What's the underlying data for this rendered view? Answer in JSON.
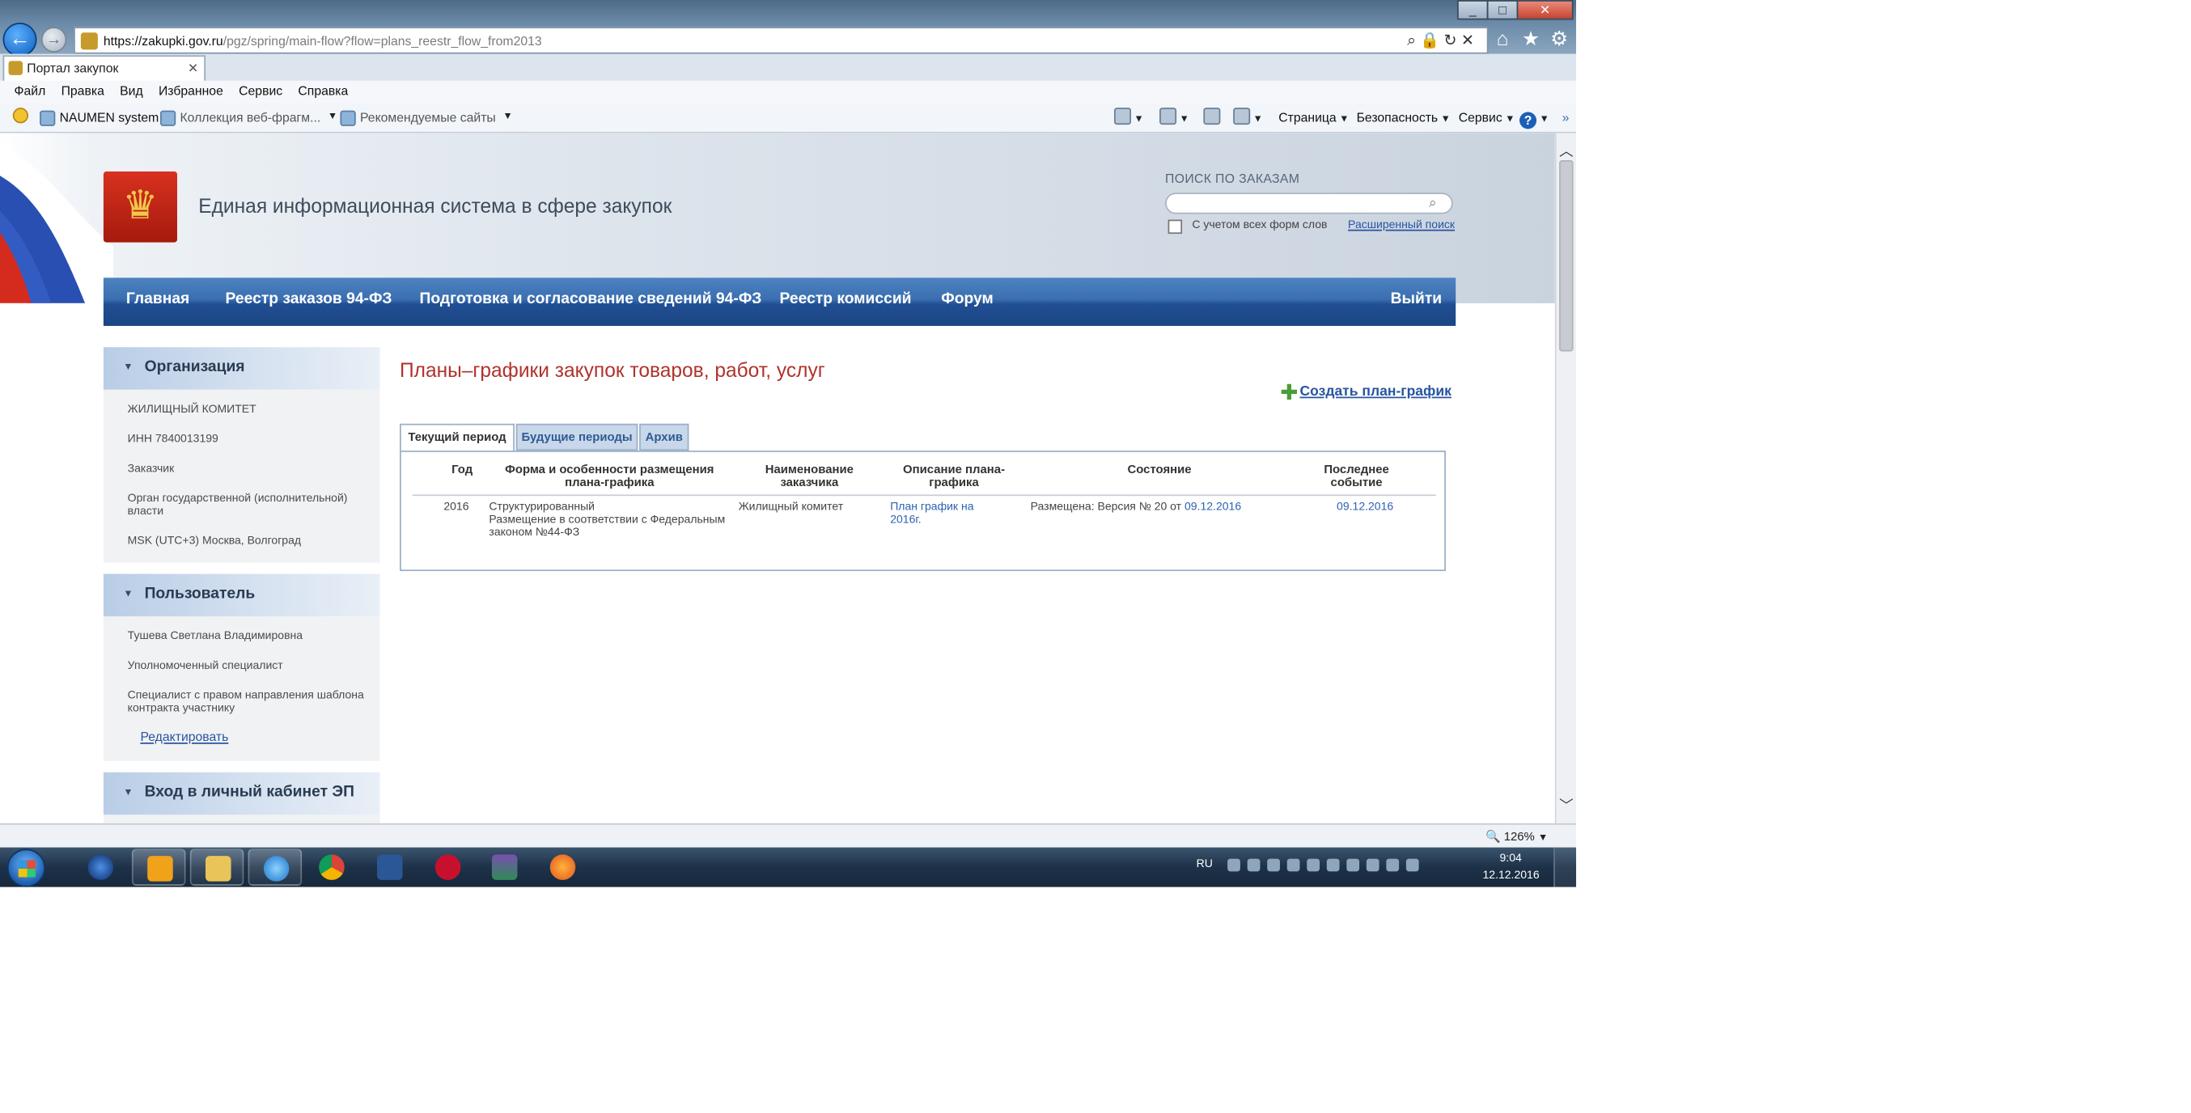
{
  "browser": {
    "url_host": "https://zakupki.gov.ru",
    "url_path": "/pgz/spring/main-flow?flow=plans_reestr_flow_from2013",
    "tab_title": "Портал закупок",
    "menu": [
      "Файл",
      "Правка",
      "Вид",
      "Избранное",
      "Сервис",
      "Справка"
    ],
    "favorites": [
      "NAUMEN system",
      "Коллекция веб-фрагм...",
      "Рекомендуемые сайты"
    ],
    "commands": {
      "page": "Страница",
      "safety": "Безопасность",
      "tools": "Сервис"
    },
    "zoom": "126%"
  },
  "site": {
    "title": "Единая информационная система в сфере закупок",
    "search_label": "ПОИСК ПО ЗАКАЗАМ",
    "search_value": "",
    "forms_checkbox_label": "С учетом всех форм слов",
    "advanced_search": "Расширенный поиск",
    "nav": {
      "home": "Главная",
      "registry94": "Реестр заказов 94-ФЗ",
      "prep94": "Подготовка и согласование сведений 94-ФЗ",
      "sep": "-",
      "commissions": "Реестр комиссий",
      "forum": "Форум",
      "logout": "Выйти"
    }
  },
  "sidebar": {
    "org": {
      "heading": "Организация",
      "name": "ЖИЛИЩНЫЙ КОМИТЕТ",
      "inn": "ИНН 7840013199",
      "role": "Заказчик",
      "type": "Орган государственной (исполнительной) власти",
      "tz": "MSK (UTC+3) Москва, Волгоград"
    },
    "user": {
      "heading": "Пользователь",
      "name": "Тушева Светлана Владимировна",
      "role1": "Уполномоченный специалист",
      "role2": "Специалист с правом направления шаблона контракта участнику",
      "edit": "Редактировать"
    },
    "cabinet": {
      "heading": "Вход в личный кабинет ЭП"
    }
  },
  "main": {
    "title": "Планы–графики закупок товаров, работ, услуг",
    "create": "Создать план-график",
    "tabs": {
      "current": "Текущий период",
      "future": "Будущие периоды",
      "archive": "Архив"
    },
    "columns": {
      "year": "Год",
      "form": "Форма и особенности размещения плана-графика",
      "customer": "Наименование заказчика",
      "desc": "Описание плана-графика",
      "state": "Состояние",
      "last": "Последнее событие"
    },
    "rows": [
      {
        "year": "2016",
        "form1": "Структурированный",
        "form2": "Размещение в соответствии с Федеральным законом №44-ФЗ",
        "customer": "Жилищный комитет",
        "desc": "План график на 2016г.",
        "state": "Размещена: Версия №  20 от",
        "state_date": "09.12.2016",
        "last": "09.12.2016"
      }
    ]
  },
  "taskbar": {
    "lang": "RU",
    "time": "9:04",
    "date": "12.12.2016"
  }
}
